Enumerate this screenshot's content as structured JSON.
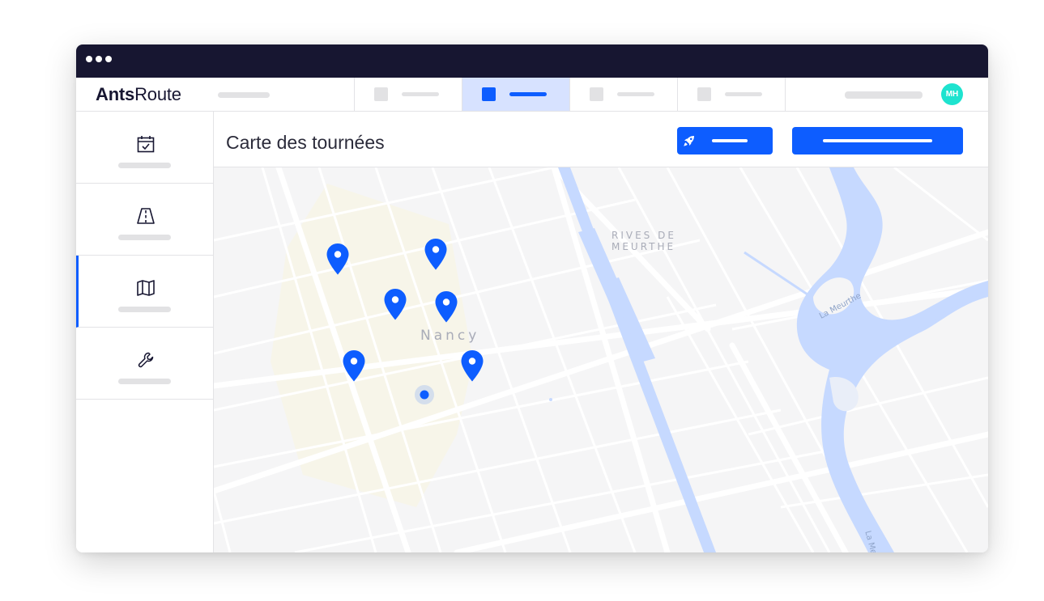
{
  "app": {
    "logo_bold": "Ants",
    "logo_regular": "Route",
    "avatar_initials": "MH"
  },
  "page": {
    "title": "Carte des tournées"
  },
  "map": {
    "labels": {
      "city": "Nancy",
      "district_line1": "RIVES DE",
      "district_line2": "MEURTHE",
      "river_1": "La Meurthe",
      "river_2": "La Me"
    }
  },
  "colors": {
    "titlebar": "#171631",
    "accent": "#0d5dff",
    "active_tab_bg": "#d7e2ff",
    "avatar": "#1ee3cf",
    "water": "#c6d9ff"
  },
  "icons": {
    "sidebar": [
      "calendar-check-icon",
      "road-icon",
      "map-icon",
      "wrench-icon"
    ],
    "primary_button": "rocket-icon",
    "markers": "map-pin-icon"
  }
}
